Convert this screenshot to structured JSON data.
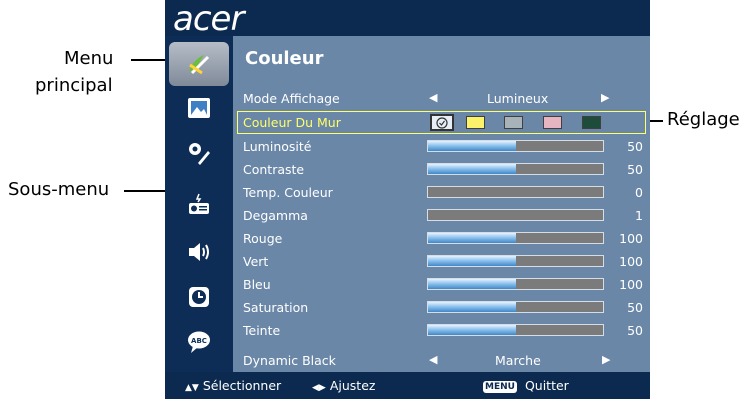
{
  "callouts": {
    "main_menu_line1": "Menu",
    "main_menu_line2": "principal",
    "sub_menu": "Sous-menu",
    "adjust": "Réglage"
  },
  "logo": "acer",
  "sidebar": {
    "items": [
      {
        "icon": "color-brush-icon",
        "active": true
      },
      {
        "icon": "image-icon",
        "active": false
      },
      {
        "icon": "settings-tools-icon",
        "active": false
      },
      {
        "icon": "projector-management-icon",
        "active": false
      },
      {
        "icon": "speaker-audio-icon",
        "active": false
      },
      {
        "icon": "clock-timer-icon",
        "active": false
      },
      {
        "icon": "language-abc-icon",
        "active": false
      }
    ]
  },
  "panel": {
    "title": "Couleur",
    "display_mode": {
      "label": "Mode Affichage",
      "value": "Lumineux"
    },
    "wall_color": {
      "label": "Couleur Du Mur",
      "swatches": [
        "#e8eef5",
        "#fbf36a",
        "#a8b2b9",
        "#e7b4c2",
        "#1d4d3a"
      ]
    },
    "sliders": [
      {
        "label": "Luminosité",
        "value": "50",
        "level": 50
      },
      {
        "label": "Contraste",
        "value": "50",
        "level": 50
      },
      {
        "label": "Temp. Couleur",
        "value": "0",
        "level": 0
      },
      {
        "label": "Degamma",
        "value": "1",
        "level": 0
      },
      {
        "label": "Rouge",
        "value": "100",
        "level": 50
      },
      {
        "label": "Vert",
        "value": "100",
        "level": 50
      },
      {
        "label": "Bleu",
        "value": "100",
        "level": 50
      },
      {
        "label": "Saturation",
        "value": "50",
        "level": 50
      },
      {
        "label": "Teinte",
        "value": "50",
        "level": 50
      }
    ],
    "dynamic_black": {
      "label": "Dynamic Black",
      "value": "Marche"
    }
  },
  "footer": {
    "select_hint": "Sélectionner",
    "adjust_hint": "Ajustez",
    "menu_key": "MENU",
    "quit_hint": "Quitter"
  },
  "colors": {
    "osd_background": "#0c2a4f",
    "panel_background": "#6a87a8",
    "highlight": "#ffff66"
  }
}
